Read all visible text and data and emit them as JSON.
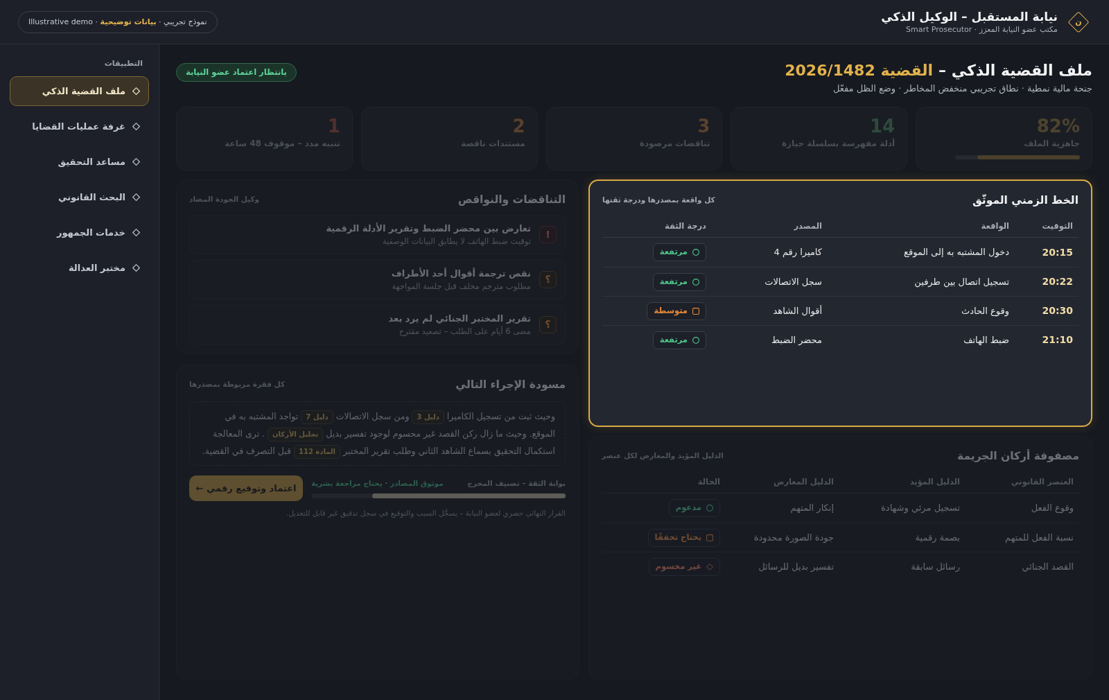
{
  "header": {
    "logo_letter": "ن",
    "title": "نيابة المستقبل – الوكيل الذكي",
    "subtitle": "مكتب عضو النيابة المعزز · Smart Prosecutor",
    "demo_badge": "نموذج تجريبي · **بيانات توضيحية** · Illustrative demo"
  },
  "sidebar": {
    "heading": "التطبيقات",
    "items": [
      {
        "label": "ملف القضية الذكي",
        "selected": true
      },
      {
        "label": "غرفة عمليات القضايا",
        "selected": false
      },
      {
        "label": "مساعد التحقيق",
        "selected": false
      },
      {
        "label": "البحث القانوني",
        "selected": false
      },
      {
        "label": "خدمات الجمهور",
        "selected": false
      },
      {
        "label": "مختبر العدالة",
        "selected": false
      }
    ]
  },
  "page": {
    "title": "ملف القضية الذكي –",
    "case_number": "القضية 2026/1482",
    "subtitle": "جنحة مالية نمطية · نطاق تجريبي منخفض المخاطر · وضع الظل مفعّل",
    "status": "بانتظار اعتماد عضو النيابة"
  },
  "stats": [
    {
      "value": "82%",
      "label": "جاهزية الملف",
      "color": "#4e4330",
      "level": 0.82
    },
    {
      "value": "14",
      "label": "أدلة مفهرسة بسلسلة حيازة",
      "color": "#2e4a3c"
    },
    {
      "value": "3",
      "label": "تناقضات مرصودة",
      "color": "#5a422d"
    },
    {
      "value": "2",
      "label": "مستندات ناقصة",
      "color": "#58402c"
    },
    {
      "value": "1",
      "label": "تنبيه مدد – موقوف 48 ساعة",
      "color": "#51302f"
    }
  ],
  "timeline": {
    "highlighted": true,
    "title": "الخط الزمني الموثّق",
    "note": "كل واقعة بمصدرها ودرجة ثقتها",
    "columns": [
      "التوقيت",
      "الواقعة",
      "المصدر",
      "درجة الثقة"
    ],
    "rows": [
      {
        "time": "20:15",
        "event": "دخول المشتبه به إلى الموقع",
        "source": "كاميرا رقم 4",
        "confidence": {
          "label": "مرتفعة",
          "kind": "high"
        }
      },
      {
        "time": "20:22",
        "event": "تسجيل اتصال بين طرفين",
        "source": "سجل الاتصالات",
        "confidence": {
          "label": "مرتفعة",
          "kind": "high"
        }
      },
      {
        "time": "20:30",
        "event": "وقوع الحادث",
        "source": "أقوال الشاهد",
        "confidence": {
          "label": "متوسطة",
          "kind": "medium"
        }
      },
      {
        "time": "21:10",
        "event": "ضبط الهاتف",
        "source": "محضر الضبط",
        "confidence": {
          "label": "مرتفعة",
          "kind": "high"
        }
      }
    ]
  },
  "contradictions": {
    "highlighted": false,
    "title": "التناقضات والنواقص",
    "note": "وكيل الجودة المضاد",
    "items": [
      {
        "kind": "conflict",
        "symbol": "!",
        "title": "تعارض بين محضر الضبط وتقرير الأدلة الرقمية",
        "detail": "توقيت ضبط الهاتف لا يطابق البيانات الوصفية"
      },
      {
        "kind": "gap",
        "symbol": "؟",
        "title": "نقص ترجمة أقوال أحد الأطراف",
        "detail": "مطلوب مترجم محلف قبل جلسة المواجهة"
      },
      {
        "kind": "gap",
        "symbol": "؟",
        "title": "تقرير المختبر الجنائي لم يرد بعد",
        "detail": "مضى 6 أيام على الطلب – تصعيد مقترح"
      }
    ]
  },
  "matrix": {
    "highlighted": false,
    "title": "مصفوفة أركان الجريمة",
    "note": "الدليل المؤيد والمعارض لكل عنصر",
    "columns": [
      "العنصر القانوني",
      "الدليل المؤيد",
      "الدليل المعارض",
      "الحالة"
    ],
    "rows": [
      {
        "element": "وقوع الفعل",
        "supporting": "تسجيل مرئي وشهادة",
        "opposing": "إنكار المتهم",
        "status": {
          "label": "مدعوم",
          "kind": "supported"
        }
      },
      {
        "element": "نسبة الفعل للمتهم",
        "supporting": "بصمة رقمية",
        "opposing": "جودة الصورة محدودة",
        "status": {
          "label": "يحتاج تحققًا",
          "kind": "needs_check"
        }
      },
      {
        "element": "القصد الجنائي",
        "supporting": "رسائل سابقة",
        "opposing": "تفسير بديل للرسائل",
        "status": {
          "label": "غير محسوم",
          "kind": "undecided"
        }
      }
    ]
  },
  "draft": {
    "highlighted": false,
    "title": "مسودة الإجراء التالي",
    "note": "كل فقرة مربوطة بمصدرها",
    "paragraph": [
      {
        "kind": "text",
        "text": "وحيث ثبت من تسجيل الكاميرا"
      },
      {
        "kind": "ref",
        "text": "دليل 3"
      },
      {
        "kind": "text",
        "text": "ومن سجل الاتصالات"
      },
      {
        "kind": "ref",
        "text": "دليل 7"
      },
      {
        "kind": "text",
        "text": "تواجد المشتبه به في الموقع. وحيث ما زال ركن القصد غير محسوم لوجود تفسير بديل"
      },
      {
        "kind": "ref",
        "text": "تحليل الأركان"
      },
      {
        "kind": "text",
        "text": ". ترى المعالجة استكمال التحقيق بسماع الشاهد الثاني وطلب تقرير المختبر"
      },
      {
        "kind": "ref",
        "text": "المادة 112"
      },
      {
        "kind": "text",
        "text": "قبل التصرف في القضية."
      }
    ],
    "gate": {
      "label": "بوابة الثقة – تصنيف المخرج",
      "verdict": "موثوق المصادر · يحتاج مراجعة بشرية",
      "level": 0.76
    },
    "approve_button": "اعتماد وتوقيع رقمي ←",
    "disclaimer": "القرار النهائي حصري لعضو النيابة – يسجَّل السبب والتوقيع في سجل تدقيق غير قابل للتعديل."
  }
}
